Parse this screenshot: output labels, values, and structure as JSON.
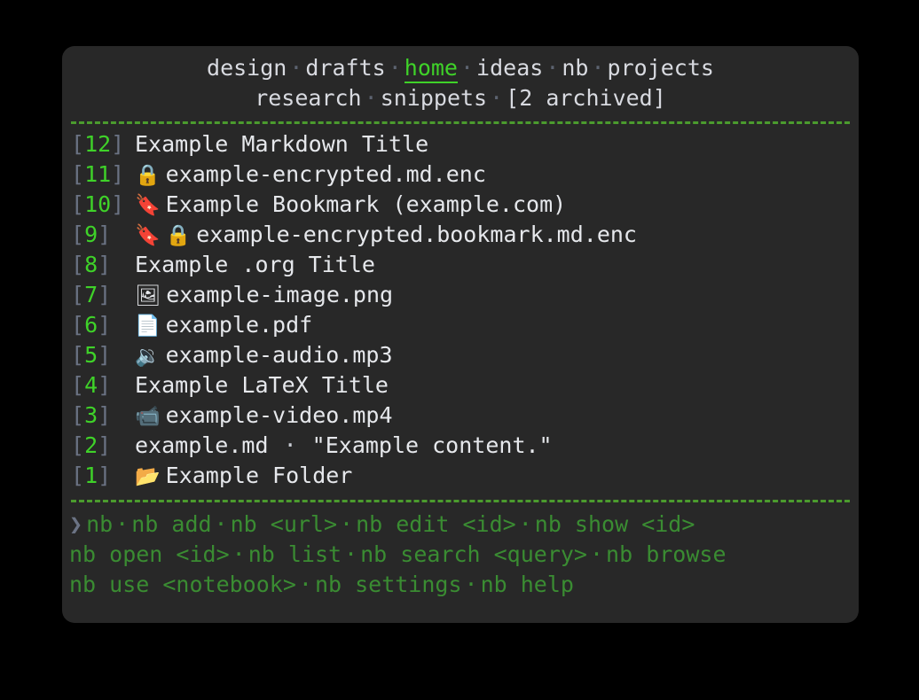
{
  "window": {
    "background": "#282828",
    "page_background": "#000000"
  },
  "colors": {
    "accent_green": "#3fd229",
    "footer_green": "#3a8c32",
    "rule_green": "#4b9b2e",
    "bracket_gray": "#6b7384",
    "text_white": "#e6e8ec",
    "separator_gray": "#5c6370"
  },
  "header": {
    "row1": [
      {
        "label": "design",
        "selected": false
      },
      {
        "label": "drafts",
        "selected": false
      },
      {
        "label": "home",
        "selected": true
      },
      {
        "label": "ideas",
        "selected": false
      },
      {
        "label": "nb",
        "selected": false
      },
      {
        "label": "projects",
        "selected": false
      }
    ],
    "row2": [
      {
        "label": "research",
        "selected": false
      },
      {
        "label": "snippets",
        "selected": false
      }
    ],
    "archived_label": "[2 archived]",
    "separator": "·"
  },
  "items": [
    {
      "id": "12",
      "icons": [],
      "title": "Example Markdown Title",
      "excerpt": ""
    },
    {
      "id": "11",
      "icons": [
        "🔒"
      ],
      "title": "example-encrypted.md.enc",
      "excerpt": ""
    },
    {
      "id": "10",
      "icons": [
        "🔖"
      ],
      "title": "Example Bookmark (example.com)",
      "excerpt": ""
    },
    {
      "id": "9",
      "icons": [
        "🔖",
        "🔒"
      ],
      "title": "example-encrypted.bookmark.md.enc",
      "excerpt": ""
    },
    {
      "id": "8",
      "icons": [],
      "title": "Example .org Title",
      "excerpt": ""
    },
    {
      "id": "7",
      "icons": [
        "🖼"
      ],
      "title": "example-image.png",
      "excerpt": ""
    },
    {
      "id": "6",
      "icons": [
        "📄"
      ],
      "title": "example.pdf",
      "excerpt": ""
    },
    {
      "id": "5",
      "icons": [
        "🔉"
      ],
      "title": "example-audio.mp3",
      "excerpt": ""
    },
    {
      "id": "4",
      "icons": [],
      "title": "Example LaTeX Title",
      "excerpt": ""
    },
    {
      "id": "3",
      "icons": [
        "📹"
      ],
      "title": "example-video.mp4",
      "excerpt": ""
    },
    {
      "id": "2",
      "icons": [],
      "title": "example.md",
      "excerpt": "\"Example content.\""
    },
    {
      "id": "1",
      "icons": [
        "📂"
      ],
      "title": "Example Folder",
      "excerpt": ""
    }
  ],
  "footer": {
    "prompt": "❯",
    "separator": "·",
    "lines": [
      [
        "nb",
        "nb add",
        "nb <url>",
        "nb edit <id>",
        "nb show <id>"
      ],
      [
        "nb open <id>",
        "nb list",
        "nb search <query>",
        "nb browse"
      ],
      [
        "nb use <notebook>",
        "nb settings",
        "nb help"
      ]
    ]
  }
}
